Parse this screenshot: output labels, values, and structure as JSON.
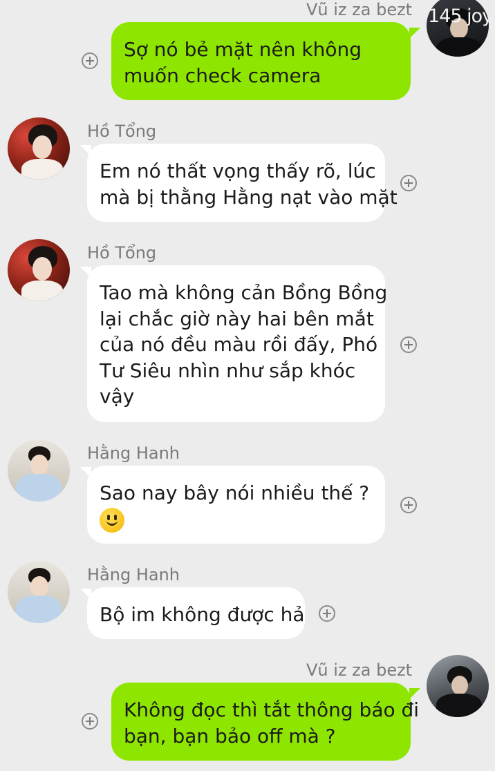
{
  "messages": [
    {
      "sender": "Vũ iz za bezt",
      "side": "right",
      "avatar_caption": "145 joy",
      "lines": [
        "Sợ nó bẻ mặt nên không",
        "muốn check camera"
      ]
    },
    {
      "sender": "Hồ Tổng",
      "side": "left",
      "lines": [
        "Em nó thất vọng thấy rõ, lúc",
        "mà bị thằng Hằng nạt vào mặt"
      ]
    },
    {
      "sender": "Hồ Tổng",
      "side": "left",
      "lines": [
        "Tao mà không cản Bồng Bồng",
        "lại chắc giờ này hai bên mắt",
        "của nó đều màu rồi đấy, Phó",
        "Tư Siêu nhìn như sắp khóc",
        "vậy"
      ]
    },
    {
      "sender": "Hằng Hanh",
      "side": "left",
      "lines": [
        "Sao nay bây nói nhiều thế ?"
      ],
      "emoji": "slightly-smiling-face"
    },
    {
      "sender": "Hằng Hanh",
      "side": "left",
      "lines": [
        "Bộ im không được hả"
      ]
    },
    {
      "sender": "Vũ iz za bezt",
      "side": "right",
      "lines": [
        "Không đọc thì tắt thông báo đi",
        "bạn, bạn bảo off mà ?"
      ]
    }
  ],
  "icons": {
    "add_reaction": "circle-plus-icon"
  },
  "colors": {
    "background": "#ececec",
    "incoming_bubble": "#ffffff",
    "outgoing_bubble": "#8ee600",
    "sender_name": "#7a7a7a"
  }
}
